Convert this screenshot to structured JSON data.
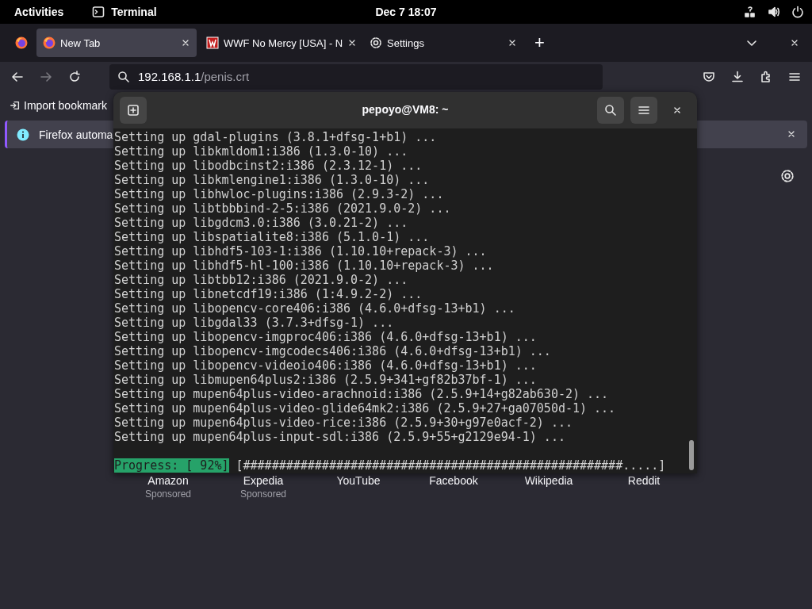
{
  "top_bar": {
    "activities": "Activities",
    "app_name": "Terminal",
    "clock": "Dec 7  18:07"
  },
  "browser": {
    "tabs": [
      {
        "title": "New Tab",
        "selected": true,
        "kind": "firefox"
      },
      {
        "title": "WWF No Mercy [USA] - N",
        "selected": false,
        "kind": "game"
      },
      {
        "title": "Settings",
        "selected": false,
        "kind": "settings"
      }
    ],
    "new_tab_button": "+",
    "url": {
      "host": "192.168.1.1",
      "path": "/penis.crt"
    },
    "bookmarks_bar": {
      "import": "Import bookmark"
    },
    "notification": {
      "text": "Firefox automa"
    },
    "shortcuts": [
      {
        "label": "Amazon",
        "sponsored": "Sponsored"
      },
      {
        "label": "Expedia",
        "sponsored": "Sponsored"
      },
      {
        "label": "YouTube"
      },
      {
        "label": "Facebook"
      },
      {
        "label": "Wikipedia"
      },
      {
        "label": "Reddit"
      }
    ]
  },
  "terminal": {
    "title": "pepoyo@VM8: ~",
    "lines": [
      "Setting up gdal-plugins (3.8.1+dfsg-1+b1) ...",
      "Setting up libkmldom1:i386 (1.3.0-10) ...",
      "Setting up libodbcinst2:i386 (2.3.12-1) ...",
      "Setting up libkmlengine1:i386 (1.3.0-10) ...",
      "Setting up libhwloc-plugins:i386 (2.9.3-2) ...",
      "Setting up libtbbbind-2-5:i386 (2021.9.0-2) ...",
      "Setting up libgdcm3.0:i386 (3.0.21-2) ...",
      "Setting up libspatialite8:i386 (5.1.0-1) ...",
      "Setting up libhdf5-103-1:i386 (1.10.10+repack-3) ...",
      "Setting up libhdf5-hl-100:i386 (1.10.10+repack-3) ...",
      "Setting up libtbb12:i386 (2021.9.0-2) ...",
      "Setting up libnetcdf19:i386 (1:4.9.2-2) ...",
      "Setting up libopencv-core406:i386 (4.6.0+dfsg-13+b1) ...",
      "Setting up libgdal33 (3.7.3+dfsg-1) ...",
      "Setting up libopencv-imgproc406:i386 (4.6.0+dfsg-13+b1) ...",
      "Setting up libopencv-imgcodecs406:i386 (4.6.0+dfsg-13+b1) ...",
      "Setting up libopencv-videoio406:i386 (4.6.0+dfsg-13+b1) ...",
      "Setting up libmupen64plus2:i386 (2.5.9+341+gf82b37bf-1) ...",
      "Setting up mupen64plus-video-arachnoid:i386 (2.5.9+14+g82ab630-2) ...",
      "Setting up mupen64plus-video-glide64mk2:i386 (2.5.9+27+ga07050d-1) ...",
      "Setting up mupen64plus-video-rice:i386 (2.5.9+30+g97e0acf-2) ...",
      "Setting up mupen64plus-input-sdl:i386 (2.5.9+55+g2129e94-1) ..."
    ],
    "progress": {
      "label": "Progress: [ 92%]",
      "bar": "[#####################################################.....]"
    }
  }
}
